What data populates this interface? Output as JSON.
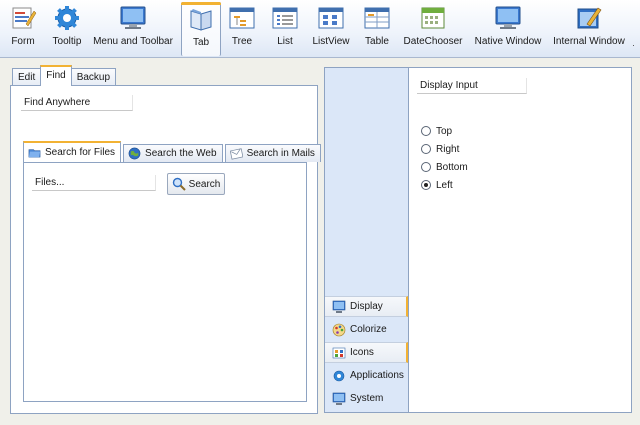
{
  "toolbar": {
    "items": [
      {
        "label": "Form",
        "icon": "form-icon"
      },
      {
        "label": "Tooltip",
        "icon": "gear-icon"
      },
      {
        "label": "Menu and Toolbar",
        "icon": "monitor-icon"
      },
      {
        "label": "Tab",
        "icon": "book-icon",
        "active": true
      },
      {
        "label": "Tree",
        "icon": "tree-window-icon"
      },
      {
        "label": "List",
        "icon": "list-window-icon"
      },
      {
        "label": "ListView",
        "icon": "listview-window-icon"
      },
      {
        "label": "Table",
        "icon": "table-window-icon"
      },
      {
        "label": "DateChooser",
        "icon": "calendar-icon"
      },
      {
        "label": "Native Window",
        "icon": "monitor-icon"
      },
      {
        "label": "Internal Window",
        "icon": "pen-window-icon"
      }
    ]
  },
  "left": {
    "tabs": [
      "Edit",
      "Find",
      "Backup"
    ],
    "selected_tab": "Find",
    "find_input_value": "Find Anywhere",
    "inner_tabs": [
      {
        "label": "Search for Files",
        "icon": "folder-search-icon"
      },
      {
        "label": "Search the Web",
        "icon": "globe-icon"
      },
      {
        "label": "Search in Mails",
        "icon": "mail-icon"
      }
    ],
    "files_input_value": "Files...",
    "search_button_label": "Search"
  },
  "right": {
    "display_input_value": "Display Input",
    "radios": [
      {
        "label": "Top",
        "checked": false
      },
      {
        "label": "Right",
        "checked": false
      },
      {
        "label": "Bottom",
        "checked": false
      },
      {
        "label": "Left",
        "checked": true
      }
    ],
    "side_tabs": [
      {
        "label": "Display",
        "icon": "monitor-icon"
      },
      {
        "label": "Colorize",
        "icon": "palette-icon"
      },
      {
        "label": "Icons",
        "icon": "icons-icon"
      },
      {
        "label": "Applications",
        "icon": "gear-icon"
      },
      {
        "label": "System",
        "icon": "monitor-icon"
      }
    ]
  },
  "colors": {
    "accent": "#f2b233",
    "border": "#8ea3c2",
    "side_bar": "#dbe7f8",
    "background": "#f0f0ea"
  }
}
